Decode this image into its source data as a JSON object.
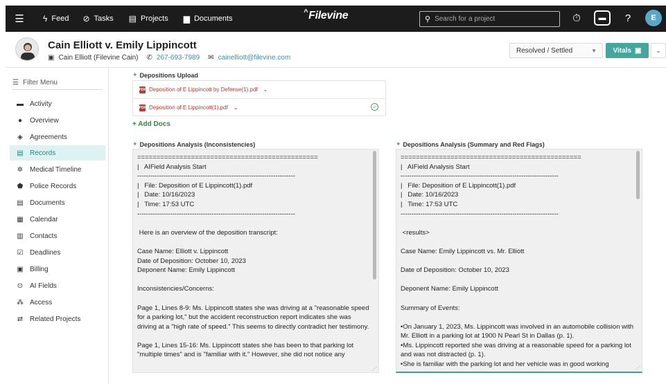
{
  "nav": {
    "items": [
      {
        "label": "Feed",
        "icon": "bolt-icon"
      },
      {
        "label": "Tasks",
        "icon": "check-circle-icon"
      },
      {
        "label": "Projects",
        "icon": "projects-icon"
      },
      {
        "label": "Documents",
        "icon": "document-icon"
      }
    ],
    "brand": "Filevine",
    "search_placeholder": "Search for a project",
    "avatar_initial": "E"
  },
  "project": {
    "title": "Cain Elliott v. Emily Lippincott",
    "client": "Cain Elliott (Filevine Cain)",
    "phone": "267-693-7989",
    "email": "cainelliott@filevine.com",
    "phase": "Resolved / Settled",
    "vitals_label": "Vitals"
  },
  "sidebar": {
    "filter_label": "Filter Menu",
    "items": [
      {
        "label": "Activity",
        "icon": "activity-icon",
        "active": false
      },
      {
        "label": "Overview",
        "icon": "info-icon",
        "active": false
      },
      {
        "label": "Agreements",
        "icon": "handshake-icon",
        "active": false
      },
      {
        "label": "Records",
        "icon": "records-icon",
        "active": true
      },
      {
        "label": "Medical Timeline",
        "icon": "medical-icon",
        "active": false
      },
      {
        "label": "Police Records",
        "icon": "badge-icon",
        "active": false
      },
      {
        "label": "Documents",
        "icon": "folder-icon",
        "active": false
      },
      {
        "label": "Calendar",
        "icon": "calendar-icon",
        "active": false
      },
      {
        "label": "Contacts",
        "icon": "contacts-icon",
        "active": false
      },
      {
        "label": "Deadlines",
        "icon": "deadline-icon",
        "active": false
      },
      {
        "label": "Billing",
        "icon": "billing-icon",
        "active": false
      },
      {
        "label": "AI Fields",
        "icon": "ai-icon",
        "active": false
      },
      {
        "label": "Access",
        "icon": "access-icon",
        "active": false
      },
      {
        "label": "Related Projects",
        "icon": "related-icon",
        "active": false
      }
    ]
  },
  "main": {
    "uploads_label": "Depositions Upload",
    "docs": [
      {
        "name": "Deposition of E Lippincott by Defense(1).pdf"
      },
      {
        "name": "Deposition of E Lippincott(1).pdf"
      }
    ],
    "add_docs": "+ Add Docs",
    "left_label": "Depositions Analysis (Inconsistencies)",
    "right_label": "Depositions Analysis (Summary and Red Flags)",
    "left_text": "===============================================\n|   AIField Analysis Start\n------------------------------------------------------------------------\n|   File: Deposition of E Lippincott(1).pdf\n|   Date: 10/16/2023\n|   Time: 17:53 UTC\n------------------------------------------------------------------------\n\n Here is an overview of the deposition transcript:\n\nCase Name: Elliott v. Lippincott\nDate of Deposition: October 10, 2023\nDeponent Name: Emily Lippincott\n\nInconsistencies/Concerns:\n\nPage 1, Lines 8-9: Ms. Lippincott states she was driving at a \"reasonable speed for a parking lot,\" but the accident reconstruction report indicates she was driving at a \"high rate of speed.\" This seems to directly contradict her testimony.\n\nPage 1, Lines 15-16: Ms. Lippincott states she has been to that parking lot \"multiple times\" and is \"familiar with it.\" However, she did not notice any",
    "right_text": "===============================================\n|   AIField Analysis Start\n------------------------------------------------------------------------\n|   File: Deposition of E Lippincott(1).pdf\n|   Date: 10/16/2023\n|   Time: 17:53 UTC\n------------------------------------------------------------------------\n\n <results>\n\nCase Name: Emily Lippincott vs. Mr. Elliott\n\nDate of Deposition: October 10, 2023\n\nDeponent Name: Emily Lippincott\n\nSummary of Events:\n\n•On January 1, 2023, Ms. Lippincott was involved in an automobile collision with Mr. Elliott in a parking lot at 1900 N Pearl St in Dallas (p. 1).\n•Ms. Lippincott reported she was driving at a reasonable speed for a parking lot and was not distracted (p. 1).\n•She is familiar with the parking lot and her vehicle was in good working"
  },
  "colors": {
    "nav_bg": "#1c1c1c",
    "accent": "#46a59d",
    "active_bg": "#dff2f2",
    "link": "#3b8fb6",
    "add_docs": "#2e8b3a"
  }
}
